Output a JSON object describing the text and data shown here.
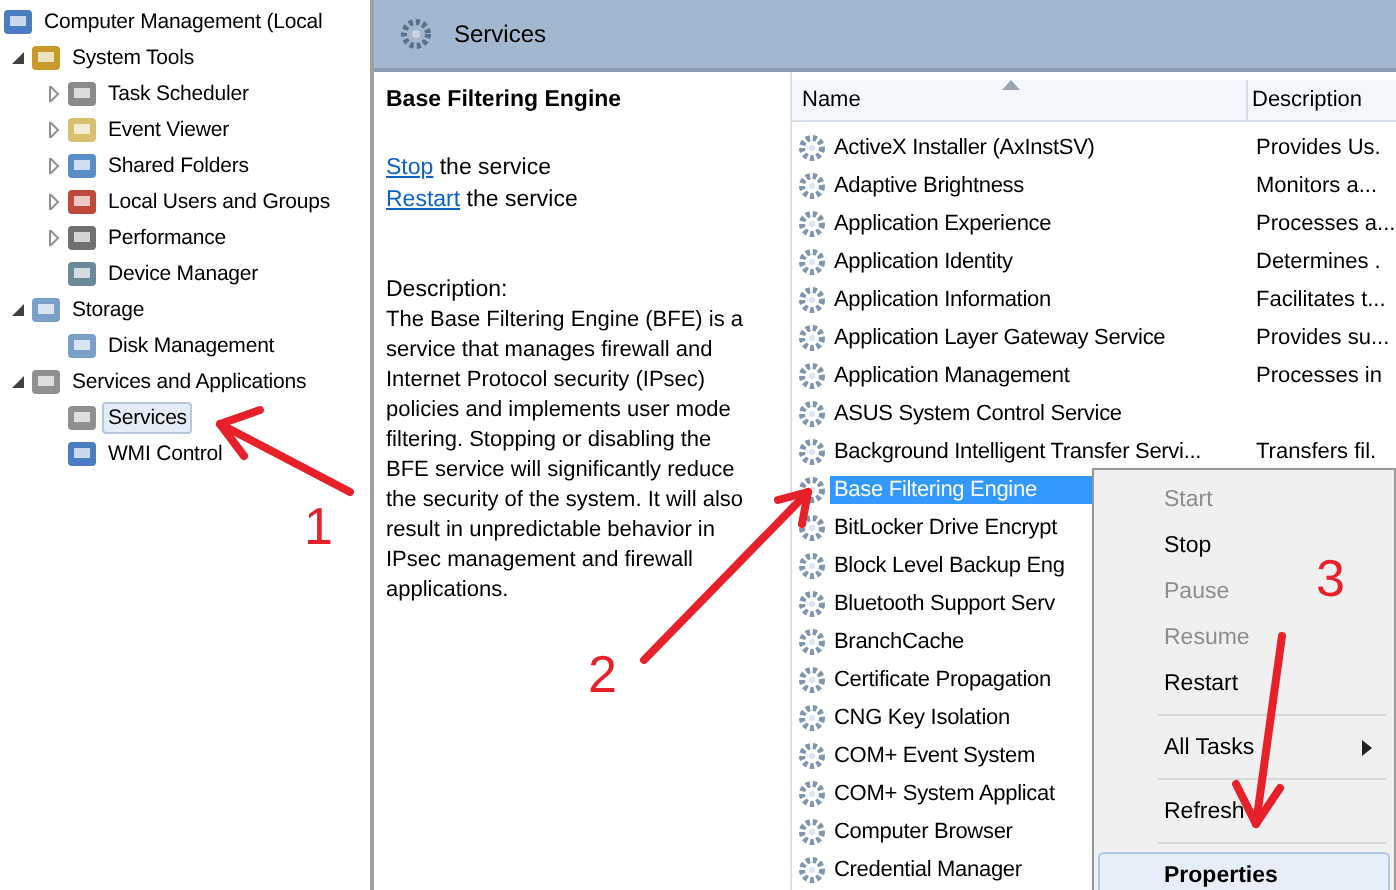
{
  "tree": [
    {
      "label": "Computer Management (Local",
      "selected": false,
      "children": [
        {
          "label": "System Tools",
          "expanded": true,
          "selected": false,
          "children": [
            {
              "label": "Task Scheduler",
              "expanded": false,
              "selected": false
            },
            {
              "label": "Event Viewer",
              "expanded": false,
              "selected": false
            },
            {
              "label": "Shared Folders",
              "expanded": false,
              "selected": false
            },
            {
              "label": "Local Users and Groups",
              "expanded": false,
              "selected": false
            },
            {
              "label": "Performance",
              "expanded": false,
              "selected": false
            },
            {
              "label": "Device Manager",
              "selected": false
            }
          ]
        },
        {
          "label": "Storage",
          "expanded": true,
          "selected": false,
          "children": [
            {
              "label": "Disk Management",
              "selected": false
            }
          ]
        },
        {
          "label": "Services and Applications",
          "expanded": true,
          "selected": false,
          "children": [
            {
              "label": "Services",
              "selected": true
            },
            {
              "label": "WMI Control",
              "selected": false
            }
          ]
        }
      ]
    }
  ],
  "panel_title": "Services",
  "details": {
    "title": "Base Filtering Engine",
    "actions": [
      {
        "link": "Stop",
        "rest": " the service"
      },
      {
        "link": "Restart",
        "rest": " the service"
      }
    ],
    "description_label": "Description:",
    "description": "The Base Filtering Engine (BFE) is a service that manages firewall and Internet Protocol security (IPsec) policies and implements user mode filtering. Stopping or disabling the BFE service will significantly reduce the security of the system. It will also result in unpredictable behavior in IPsec management and firewall applications."
  },
  "table": {
    "columns": [
      "Name",
      "Description"
    ],
    "rows": [
      {
        "name": "ActiveX Installer (AxInstSV)",
        "description": "Provides Us.",
        "selected": false
      },
      {
        "name": "Adaptive Brightness",
        "description": "Monitors a...",
        "selected": false
      },
      {
        "name": "Application Experience",
        "description": "Processes a...",
        "selected": false
      },
      {
        "name": "Application Identity",
        "description": "Determines .",
        "selected": false
      },
      {
        "name": "Application Information",
        "description": "Facilitates t...",
        "selected": false
      },
      {
        "name": "Application Layer Gateway Service",
        "description": "Provides su...",
        "selected": false
      },
      {
        "name": "Application Management",
        "description": "Processes in",
        "selected": false
      },
      {
        "name": "ASUS System Control Service",
        "selected": false
      },
      {
        "name": "Background Intelligent Transfer Servi...",
        "description": "Transfers fil.",
        "selected": false
      },
      {
        "name": "Base Filtering Engine",
        "selected": true
      },
      {
        "name": "BitLocker Drive Encrypt",
        "selected": false
      },
      {
        "name": "Block Level Backup Eng",
        "selected": false
      },
      {
        "name": "Bluetooth Support Serv",
        "selected": false
      },
      {
        "name": "BranchCache",
        "selected": false
      },
      {
        "name": "Certificate Propagation",
        "selected": false
      },
      {
        "name": "CNG Key Isolation",
        "selected": false
      },
      {
        "name": "COM+ Event System",
        "selected": false
      },
      {
        "name": "COM+ System Applicat",
        "selected": false
      },
      {
        "name": "Computer Browser",
        "selected": false
      },
      {
        "name": "Credential Manager",
        "selected": false
      }
    ]
  },
  "context_menu": [
    {
      "kind": "item",
      "label": "Start",
      "disabled": true,
      "selected": false
    },
    {
      "kind": "item",
      "label": "Stop",
      "disabled": false,
      "selected": false
    },
    {
      "kind": "item",
      "label": "Pause",
      "disabled": true,
      "selected": false
    },
    {
      "kind": "item",
      "label": "Resume",
      "disabled": true,
      "selected": false
    },
    {
      "kind": "item",
      "label": "Restart",
      "disabled": false,
      "selected": false
    },
    {
      "kind": "separator"
    },
    {
      "kind": "submenu",
      "label": "All Tasks",
      "disabled": false,
      "selected": false
    },
    {
      "kind": "separator"
    },
    {
      "kind": "item",
      "label": "Refresh",
      "disabled": false,
      "selected": false
    },
    {
      "kind": "separator"
    },
    {
      "kind": "default",
      "label": "Properties",
      "disabled": false,
      "selected": true
    }
  ],
  "annotations": [
    {
      "label": "1"
    },
    {
      "label": "2"
    },
    {
      "label": "3"
    }
  ]
}
